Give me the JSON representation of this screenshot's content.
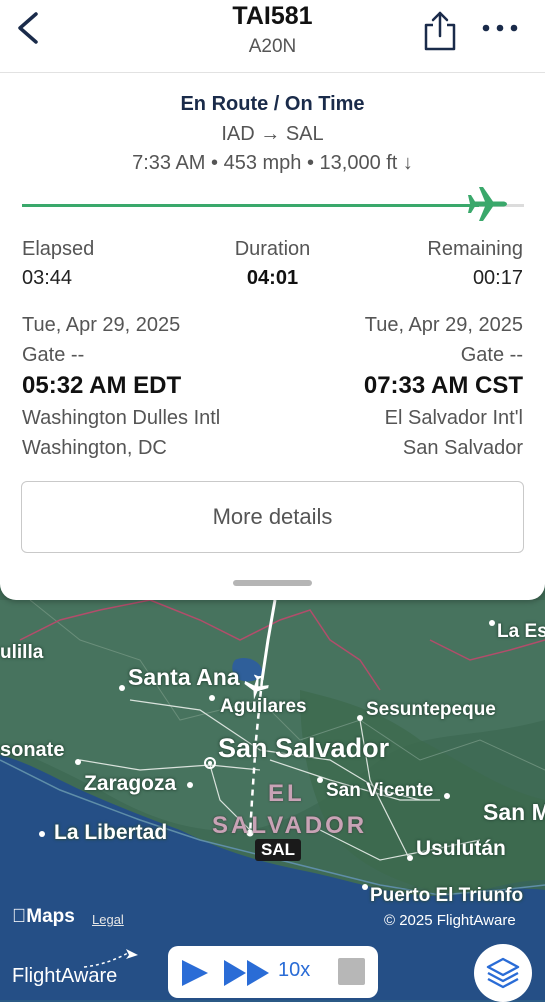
{
  "header": {
    "flight_number": "TAI581",
    "aircraft_type": "A20N"
  },
  "flight": {
    "status": "En Route / On Time",
    "route": "IAD → SAL",
    "metrics": "7:33 AM • 453 mph • 13,000 ft ↓",
    "progress": 0.93,
    "elapsed_label": "Elapsed",
    "elapsed_value": "03:44",
    "duration_label": "Duration",
    "duration_value": "04:01",
    "remaining_label": "Remaining",
    "remaining_value": "00:17"
  },
  "departure": {
    "date": "Tue, Apr 29, 2025",
    "gate": "Gate --",
    "time": "05:32 AM EDT",
    "airport": "Washington Dulles Intl",
    "city": "Washington, DC"
  },
  "arrival": {
    "date": "Tue, Apr 29, 2025",
    "gate": "Gate --",
    "time": "07:33 AM CST",
    "airport": "El Salvador Int'l",
    "city": "San Salvador"
  },
  "more_details_label": "More details",
  "map": {
    "labels": {
      "santa_ana": "Santa Ana",
      "aguilares": "Aguilares",
      "sesuntepeque": "Sesuntepeque",
      "san_salvador": "San Salvador",
      "sonsonate": "sonate",
      "zaragoza": "Zaragoza",
      "san_vicente": "San Vicente",
      "la_libertad": "La Libertad",
      "usulutan": "Usulután",
      "puerto": "Puerto El Triunfo",
      "chalatenango": "ulilla",
      "la_esperanza": "La Es",
      "san_miguel": "San M",
      "country_line1": "EL",
      "country_line2": "SALVADOR",
      "airport_code": "SAL"
    },
    "apple_maps": "Maps",
    "legal": "Legal",
    "copyright": "© 2025 FlightAware",
    "flightaware_logo": "FlightAware"
  },
  "playback": {
    "speed": "10x"
  },
  "colors": {
    "progress": "#3aa86b",
    "accent": "#2a6cd6"
  }
}
